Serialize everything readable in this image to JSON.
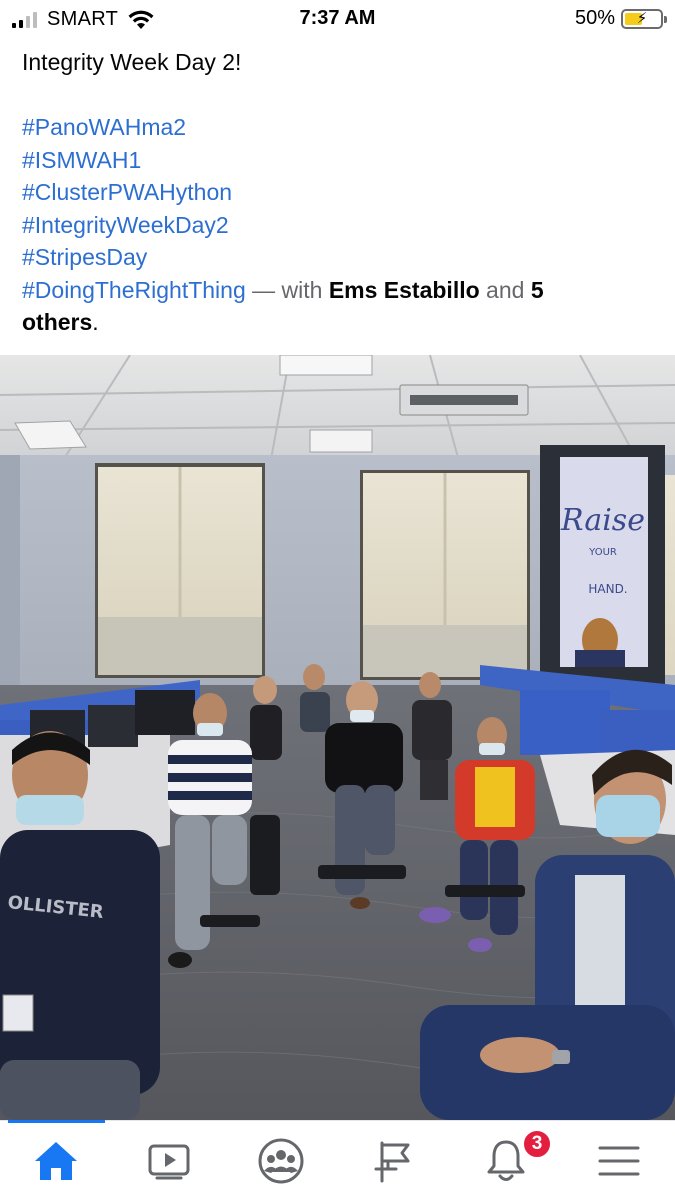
{
  "status_bar": {
    "carrier": "SMART",
    "time": "7:37 AM",
    "battery_percent": "50%",
    "battery_level": 0.5,
    "battery_color": "#f5cc1c"
  },
  "post": {
    "title": "Integrity Week Day 2!",
    "hashtags": [
      "#PanoWAHma2",
      "#ISMWAH1",
      "#ClusterPWAHython",
      "#IntegrityWeekDay2",
      "#StripesDay",
      "#DoingTheRightThing"
    ],
    "with_text": " — with ",
    "tagged_name": "Ems Estabillo",
    "and_text": " and ",
    "others_count": "5",
    "others_label": "others",
    "period": ".",
    "hashtag_color": "#2d6fd1"
  },
  "photo": {
    "poster_script": "Raise",
    "poster_small": "YOUR",
    "poster_hand": "HAND."
  },
  "tab_bar": {
    "active_color": "#1877f2",
    "notification_count": "3",
    "tabs": [
      {
        "icon": "home-icon"
      },
      {
        "icon": "watch-video-icon"
      },
      {
        "icon": "groups-icon"
      },
      {
        "icon": "pages-flag-icon"
      },
      {
        "icon": "notifications-bell-icon"
      },
      {
        "icon": "menu-icon"
      }
    ]
  }
}
